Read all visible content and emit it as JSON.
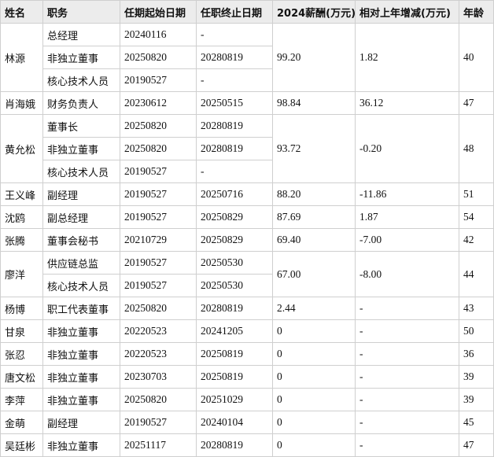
{
  "headers": [
    "姓名",
    "职务",
    "任期起始日期",
    "任职终止日期",
    "2024薪酬(万元)",
    "相对上年增减(万元)",
    "年龄"
  ],
  "people": [
    {
      "name": "林源",
      "salary": "99.20",
      "change": "1.82",
      "age": "40",
      "roles": [
        {
          "title": "总经理",
          "start": "20240116",
          "end": "-"
        },
        {
          "title": "非独立董事",
          "start": "20250820",
          "end": "20280819"
        },
        {
          "title": "核心技术人员",
          "start": "20190527",
          "end": "-"
        }
      ]
    },
    {
      "name": "肖海娥",
      "salary": "98.84",
      "change": "36.12",
      "age": "47",
      "roles": [
        {
          "title": "财务负责人",
          "start": "20230612",
          "end": "20250515"
        }
      ]
    },
    {
      "name": "黄允松",
      "salary": "93.72",
      "change": "-0.20",
      "age": "48",
      "roles": [
        {
          "title": "董事长",
          "start": "20250820",
          "end": "20280819"
        },
        {
          "title": "非独立董事",
          "start": "20250820",
          "end": "20280819"
        },
        {
          "title": "核心技术人员",
          "start": "20190527",
          "end": "-"
        }
      ]
    },
    {
      "name": "王义峰",
      "salary": "88.20",
      "change": "-11.86",
      "age": "51",
      "roles": [
        {
          "title": "副经理",
          "start": "20190527",
          "end": "20250716"
        }
      ]
    },
    {
      "name": "沈鸥",
      "salary": "87.69",
      "change": "1.87",
      "age": "54",
      "roles": [
        {
          "title": "副总经理",
          "start": "20190527",
          "end": "20250829"
        }
      ]
    },
    {
      "name": "张腾",
      "salary": "69.40",
      "change": "-7.00",
      "age": "42",
      "roles": [
        {
          "title": "董事会秘书",
          "start": "20210729",
          "end": "20250829"
        }
      ]
    },
    {
      "name": "廖洋",
      "salary": "67.00",
      "change": "-8.00",
      "age": "44",
      "roles": [
        {
          "title": "供应链总监",
          "start": "20190527",
          "end": "20250530"
        },
        {
          "title": "核心技术人员",
          "start": "20190527",
          "end": "20250530"
        }
      ]
    },
    {
      "name": "杨博",
      "salary": "2.44",
      "change": "-",
      "age": "43",
      "roles": [
        {
          "title": "职工代表董事",
          "start": "20250820",
          "end": "20280819"
        }
      ]
    },
    {
      "name": "甘泉",
      "salary": "0",
      "change": "-",
      "age": "50",
      "roles": [
        {
          "title": "非独立董事",
          "start": "20220523",
          "end": "20241205"
        }
      ]
    },
    {
      "name": "张忍",
      "salary": "0",
      "change": "-",
      "age": "36",
      "roles": [
        {
          "title": "非独立董事",
          "start": "20220523",
          "end": "20250819"
        }
      ]
    },
    {
      "name": "唐文松",
      "salary": "0",
      "change": "-",
      "age": "39",
      "roles": [
        {
          "title": "非独立董事",
          "start": "20230703",
          "end": "20250819"
        }
      ]
    },
    {
      "name": "李萍",
      "salary": "0",
      "change": "-",
      "age": "39",
      "roles": [
        {
          "title": "非独立董事",
          "start": "20250820",
          "end": "20251029"
        }
      ]
    },
    {
      "name": "金萌",
      "salary": "0",
      "change": "-",
      "age": "45",
      "roles": [
        {
          "title": "副经理",
          "start": "20190527",
          "end": "20240104"
        }
      ]
    },
    {
      "name": "吴廷彬",
      "salary": "0",
      "change": "-",
      "age": "47",
      "roles": [
        {
          "title": "非独立董事",
          "start": "20251117",
          "end": "20280819"
        }
      ]
    }
  ]
}
